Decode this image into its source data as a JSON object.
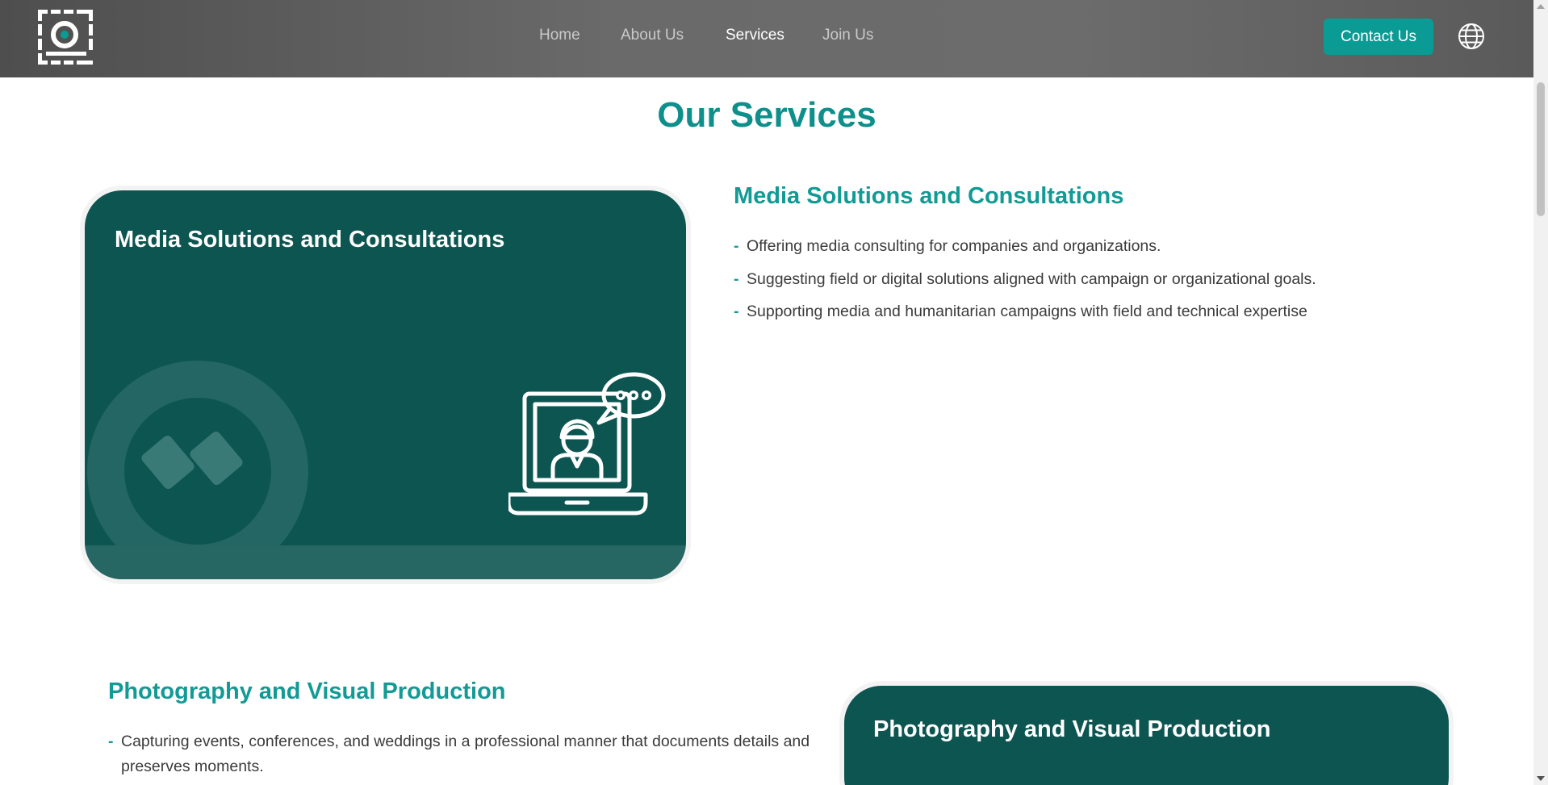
{
  "header": {
    "nav": [
      {
        "label": "Home"
      },
      {
        "label": "About Us"
      },
      {
        "label": "Services"
      },
      {
        "label": "Join Us"
      }
    ],
    "active_nav": "Services",
    "contact_button": "Contact Us",
    "language_icon": "globe-icon",
    "logo_icon": "brand-logo-icon"
  },
  "page": {
    "title": "Our Services"
  },
  "services": [
    {
      "card_title": "Media Solutions and Consultations",
      "heading": "Media Solutions and Consultations",
      "card_icon": "laptop-consultant-chat-icon",
      "bullets": [
        "Offering media consulting for companies and organizations.",
        "Suggesting field or digital solutions aligned with campaign or organizational goals.",
        "Supporting media and humanitarian campaigns with field and technical expertise"
      ]
    },
    {
      "card_title": "Photography and Visual Production",
      "heading": "Photography and Visual Production",
      "bullets": [
        "Capturing events, conferences, and weddings in a professional manner that documents details and preserves moments."
      ]
    }
  ],
  "colors": {
    "accent": "#0b9b95",
    "heading_teal": "#129a95",
    "card_bg": "#0d5551",
    "header_bg": "#5f5f5f"
  }
}
